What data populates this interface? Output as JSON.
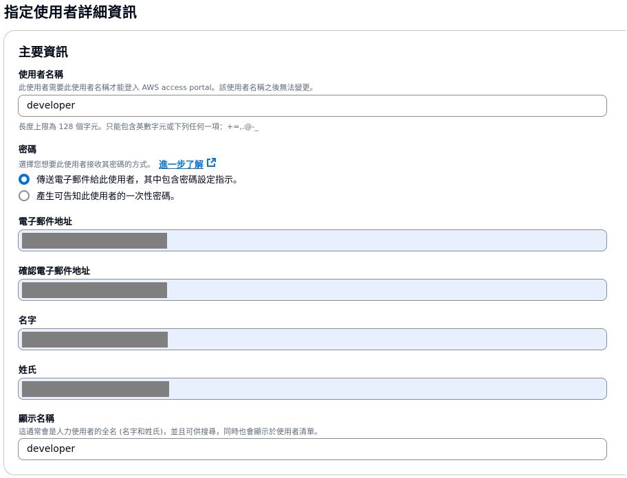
{
  "page": {
    "title": "指定使用者詳細資訊"
  },
  "section": {
    "title": "主要資訊"
  },
  "username": {
    "label": "使用者名稱",
    "description": "此使用者需要此使用者名稱才能登入 AWS access portal。該使用者名稱之後無法變更。",
    "value": "developer",
    "constraint": "長度上限為 128 個字元。只能包含英數字元或下列任何一項：+=,.@-_"
  },
  "password": {
    "label": "密碼",
    "description": "選擇您想要此使用者接收其密碼的方式。",
    "learn_more": "進一步了解",
    "options": [
      {
        "label": "傳送電子郵件給此使用者，其中包含密碼設定指示。",
        "checked": true
      },
      {
        "label": "產生可告知此使用者的一次性密碼。",
        "checked": false
      }
    ]
  },
  "email": {
    "label": "電子郵件地址"
  },
  "confirm_email": {
    "label": "確認電子郵件地址"
  },
  "first_name": {
    "label": "名字"
  },
  "last_name": {
    "label": "姓氏"
  },
  "display_name": {
    "label": "顯示名稱",
    "description": "這通常會是人力使用者的全名 (名字和姓氏)，並且可供搜尋，同時也會顯示於使用者清單。",
    "value": "developer"
  },
  "colors": {
    "accent": "#0972d3",
    "autofill_bg": "#e8f0fe",
    "redaction": "#7f7f7f"
  }
}
